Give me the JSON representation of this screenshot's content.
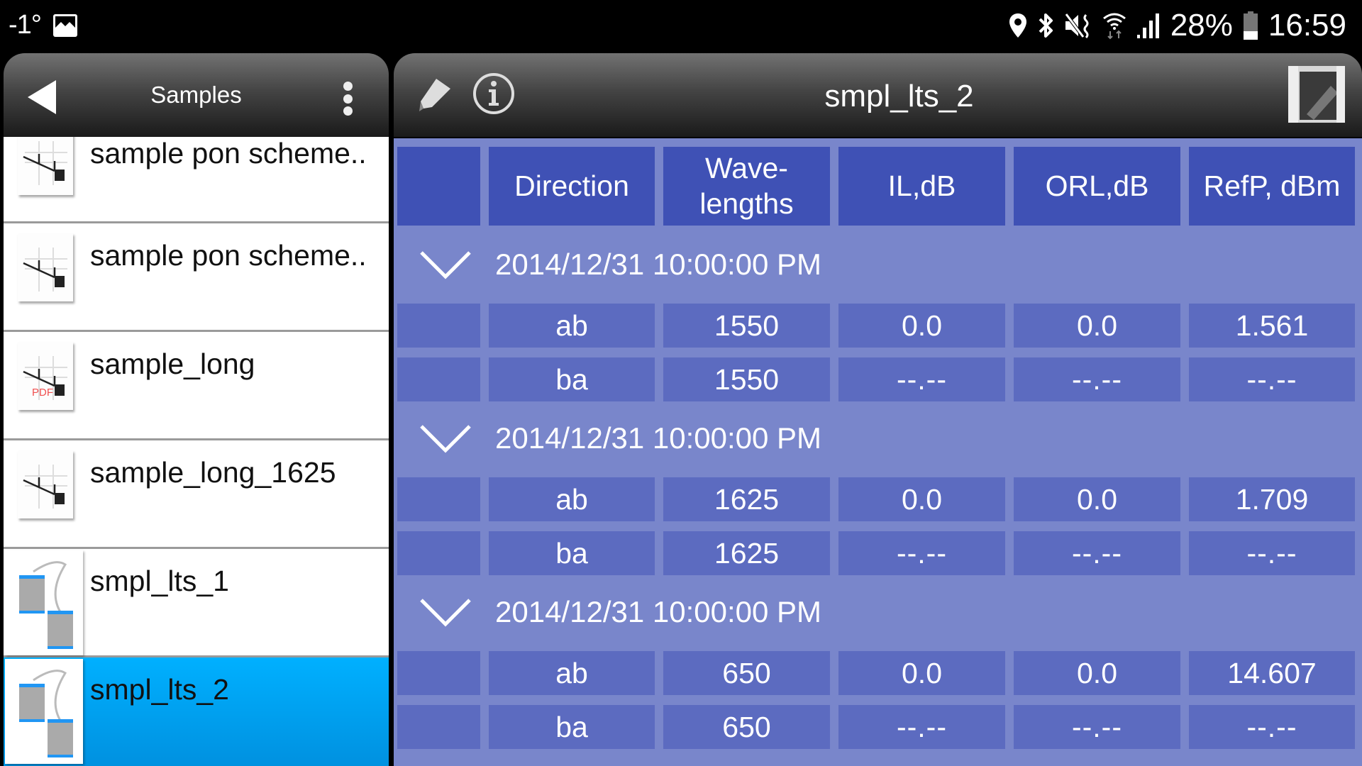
{
  "status_bar": {
    "temperature": "-1°",
    "left_icons": [
      "gallery-icon"
    ],
    "right_icons": [
      "location-icon",
      "bluetooth-icon",
      "mute-vibrate-icon",
      "wifi-icon",
      "signal-icon",
      "battery-icon"
    ],
    "battery_percent": "28%",
    "battery_level": 0.28,
    "time": "16:59"
  },
  "left_panel": {
    "title": "Samples",
    "back_icon": "back-arrow-icon",
    "menu_icon": "more-vert-icon",
    "files": [
      {
        "name": "sample pon scheme..",
        "icon": "pon-scheme-icon",
        "selected": false
      },
      {
        "name": "sample pon scheme..",
        "icon": "pon-scheme-icon",
        "selected": false
      },
      {
        "name": "sample_long",
        "icon": "pon-scheme-pdf-icon",
        "icon_badge": "PDF",
        "selected": false
      },
      {
        "name": "sample_long_1625",
        "icon": "pon-scheme-icon",
        "selected": false
      },
      {
        "name": "smpl_lts_1",
        "icon": "lts-devices-icon",
        "selected": false
      },
      {
        "name": "smpl_lts_2",
        "icon": "lts-devices-icon",
        "selected": true
      }
    ]
  },
  "right_panel": {
    "title": "smpl_lts_2",
    "toolbar_icons": [
      "pencil-icon",
      "info-icon",
      "edit-report-icon"
    ],
    "columns": [
      "",
      "Direction",
      "Wave-\nlengths",
      "IL,dB",
      "ORL,dB",
      "RefP, dBm"
    ],
    "groups": [
      {
        "timestamp": "2014/12/31 10:00:00 PM",
        "rows": [
          {
            "direction": "ab",
            "wavelength": "1550",
            "il": "0.0",
            "orl": "0.0",
            "refp": "1.561"
          },
          {
            "direction": "ba",
            "wavelength": "1550",
            "il": "--.--",
            "orl": "--.--",
            "refp": "--.--"
          }
        ]
      },
      {
        "timestamp": "2014/12/31 10:00:00 PM",
        "rows": [
          {
            "direction": "ab",
            "wavelength": "1625",
            "il": "0.0",
            "orl": "0.0",
            "refp": "1.709"
          },
          {
            "direction": "ba",
            "wavelength": "1625",
            "il": "--.--",
            "orl": "--.--",
            "refp": "--.--"
          }
        ]
      },
      {
        "timestamp": "2014/12/31 10:00:00 PM",
        "rows": [
          {
            "direction": "ab",
            "wavelength": "650",
            "il": "0.0",
            "orl": "0.0",
            "refp": "14.607"
          },
          {
            "direction": "ba",
            "wavelength": "650",
            "il": "--.--",
            "orl": "--.--",
            "refp": "--.--"
          }
        ]
      }
    ]
  },
  "colors": {
    "table_bg": "#7986cb",
    "header_cell": "#3f51b5",
    "data_cell": "#5c6bc0",
    "selected_item": "#00a5f5",
    "lts_icon_accent": "#2196f3",
    "pdf_badge": "#f05050"
  }
}
